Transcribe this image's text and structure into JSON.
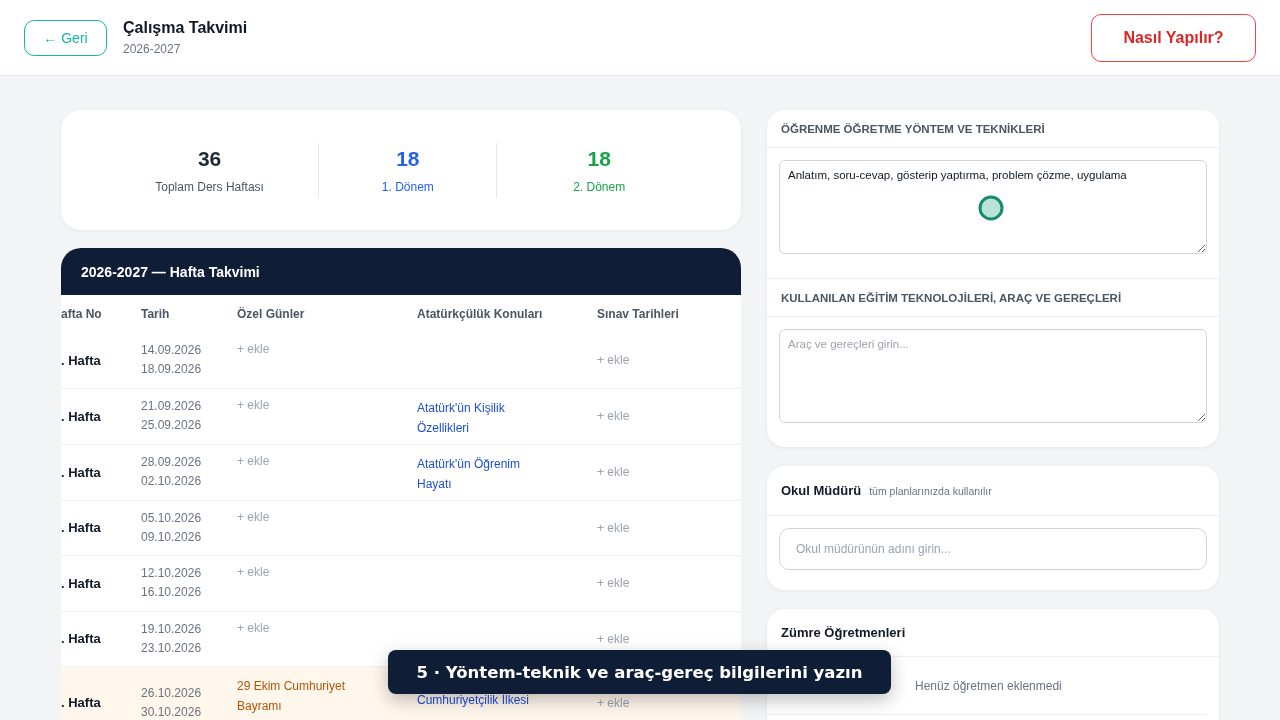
{
  "header": {
    "back_button": "← Geri",
    "title": "Çalışma Takvimi",
    "subtitle": "2026-2027",
    "help_button": "Nasıl Yapılır?"
  },
  "stats": [
    {
      "value": "36",
      "label": "Toplam Ders Haftası",
      "color": "#1f2937"
    },
    {
      "value": "18",
      "label": "1. Dönem",
      "color": "#2563eb"
    },
    {
      "value": "18",
      "label": "2. Dönem",
      "color": "#16a34a"
    }
  ],
  "week_table": {
    "title": "2026-2027 — Hafta Takvimi",
    "columns": [
      "afta No",
      "Tarih",
      "Özel Günler",
      "Atatürkçülük Konuları",
      "Sınav Tarihleri"
    ],
    "rows": [
      {
        "week": ". Hafta",
        "dates": [
          "14.09.2026",
          "18.09.2026"
        ],
        "special_day": {
          "kind": "add",
          "text": "+ ekle"
        },
        "topic": "",
        "exam": "+ ekle",
        "highlighted": false
      },
      {
        "week": ". Hafta",
        "dates": [
          "21.09.2026",
          "25.09.2026"
        ],
        "special_day": {
          "kind": "add",
          "text": "+ ekle"
        },
        "topic": "Atatürk'ün Kişilik Özellikleri",
        "exam": "+ ekle",
        "highlighted": false
      },
      {
        "week": ". Hafta",
        "dates": [
          "28.09.2026",
          "02.10.2026"
        ],
        "special_day": {
          "kind": "add",
          "text": "+ ekle"
        },
        "topic": "Atatürk'ün Öğrenim Hayatı",
        "exam": "+ ekle",
        "highlighted": false
      },
      {
        "week": ". Hafta",
        "dates": [
          "05.10.2026",
          "09.10.2026"
        ],
        "special_day": {
          "kind": "add",
          "text": "+ ekle"
        },
        "topic": "",
        "exam": "+ ekle",
        "highlighted": false
      },
      {
        "week": ". Hafta",
        "dates": [
          "12.10.2026",
          "16.10.2026"
        ],
        "special_day": {
          "kind": "add",
          "text": "+ ekle"
        },
        "topic": "",
        "exam": "+ ekle",
        "highlighted": false
      },
      {
        "week": ". Hafta",
        "dates": [
          "19.10.2026",
          "23.10.2026"
        ],
        "special_day": {
          "kind": "add",
          "text": "+ ekle"
        },
        "topic": "",
        "exam": "+ ekle",
        "highlighted": false
      },
      {
        "week": ". Hafta",
        "dates": [
          "26.10.2026",
          "30.10.2026"
        ],
        "special_day": {
          "kind": "event",
          "text": "29 Ekim Cumhuriyet Bayramı"
        },
        "topic": "Cumhuriyetçilik İlkesi",
        "exam": "+ ekle",
        "highlighted": true
      }
    ]
  },
  "methods": {
    "title": "ÖĞRENME ÖĞRETME YÖNTEM VE TEKNİKLERİ",
    "value": "Anlatım, soru-cevap, gösterip yaptırma, problem çözme, uygulama"
  },
  "materials": {
    "title": "KULLANILAN EĞİTİM TEKNOLOJİLERİ, ARAÇ VE GEREÇLERİ",
    "placeholder": "Araç ve gereçleri girin..."
  },
  "principal": {
    "title": "Okul Müdürü",
    "note": "tüm planlarınızda kullanılır",
    "placeholder": "Okul müdürünün adını girin..."
  },
  "teachers": {
    "title": "Zümre Öğretmenleri",
    "empty_text": "Henüz öğretmen eklenmedi"
  },
  "toast": "5 · Yöntem-teknik ve araç-gereç bilgilerini yazın"
}
